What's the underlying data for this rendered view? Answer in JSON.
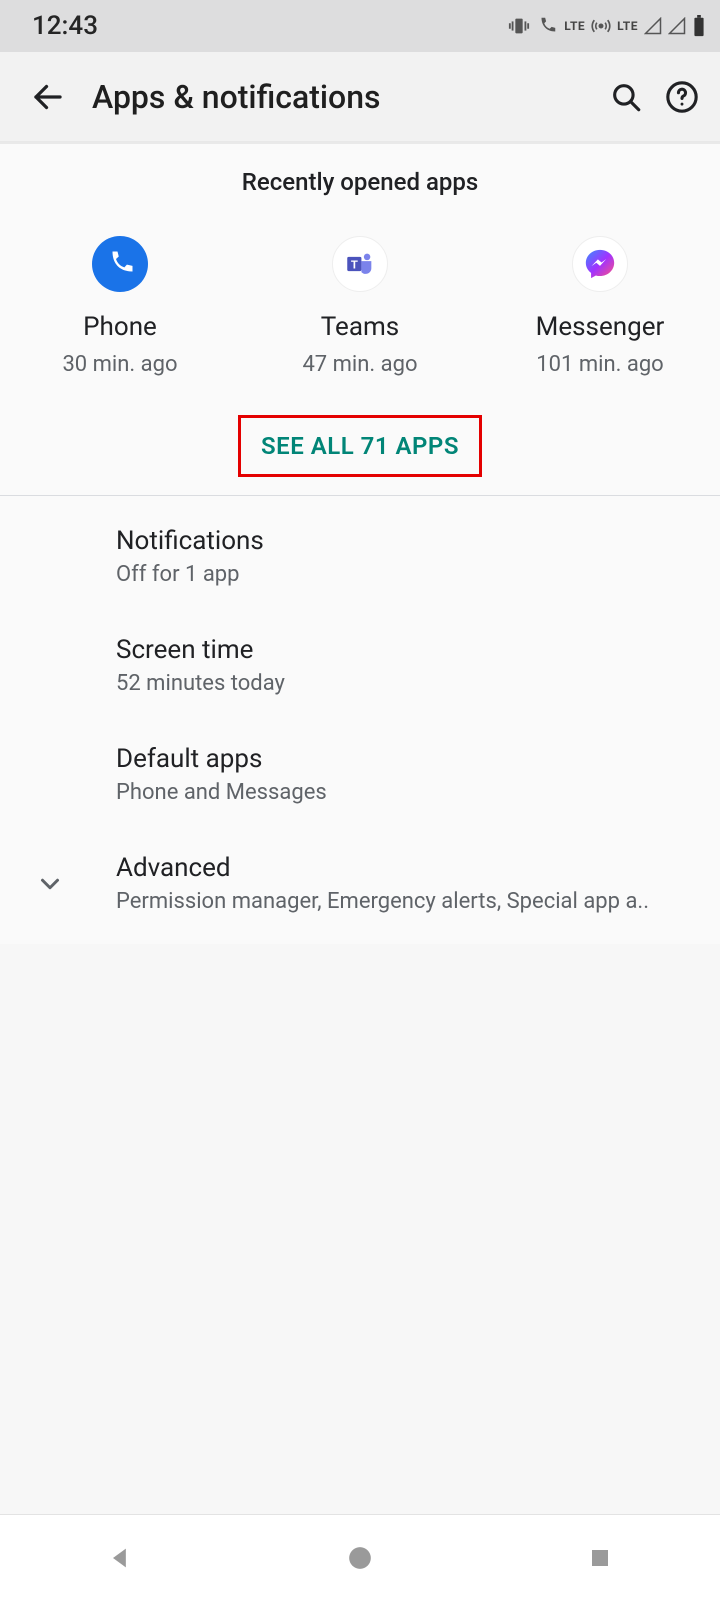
{
  "status": {
    "time": "12:43",
    "lte_label_1": "LTE",
    "lte_label_2": "LTE"
  },
  "header": {
    "title": "Apps & notifications"
  },
  "recent": {
    "section_title": "Recently opened apps",
    "apps": [
      {
        "name": "Phone",
        "subtitle": "30 min. ago"
      },
      {
        "name": "Teams",
        "subtitle": "47 min. ago"
      },
      {
        "name": "Messenger",
        "subtitle": "101 min. ago"
      }
    ],
    "see_all_label": "SEE ALL 71 APPS"
  },
  "settings": {
    "notifications": {
      "title": "Notifications",
      "subtitle": "Off for 1 app"
    },
    "screen_time": {
      "title": "Screen time",
      "subtitle": "52 minutes today"
    },
    "default_apps": {
      "title": "Default apps",
      "subtitle": "Phone and Messages"
    },
    "advanced": {
      "title": "Advanced",
      "subtitle": "Permission manager, Emergency alerts, Special app a.."
    }
  }
}
